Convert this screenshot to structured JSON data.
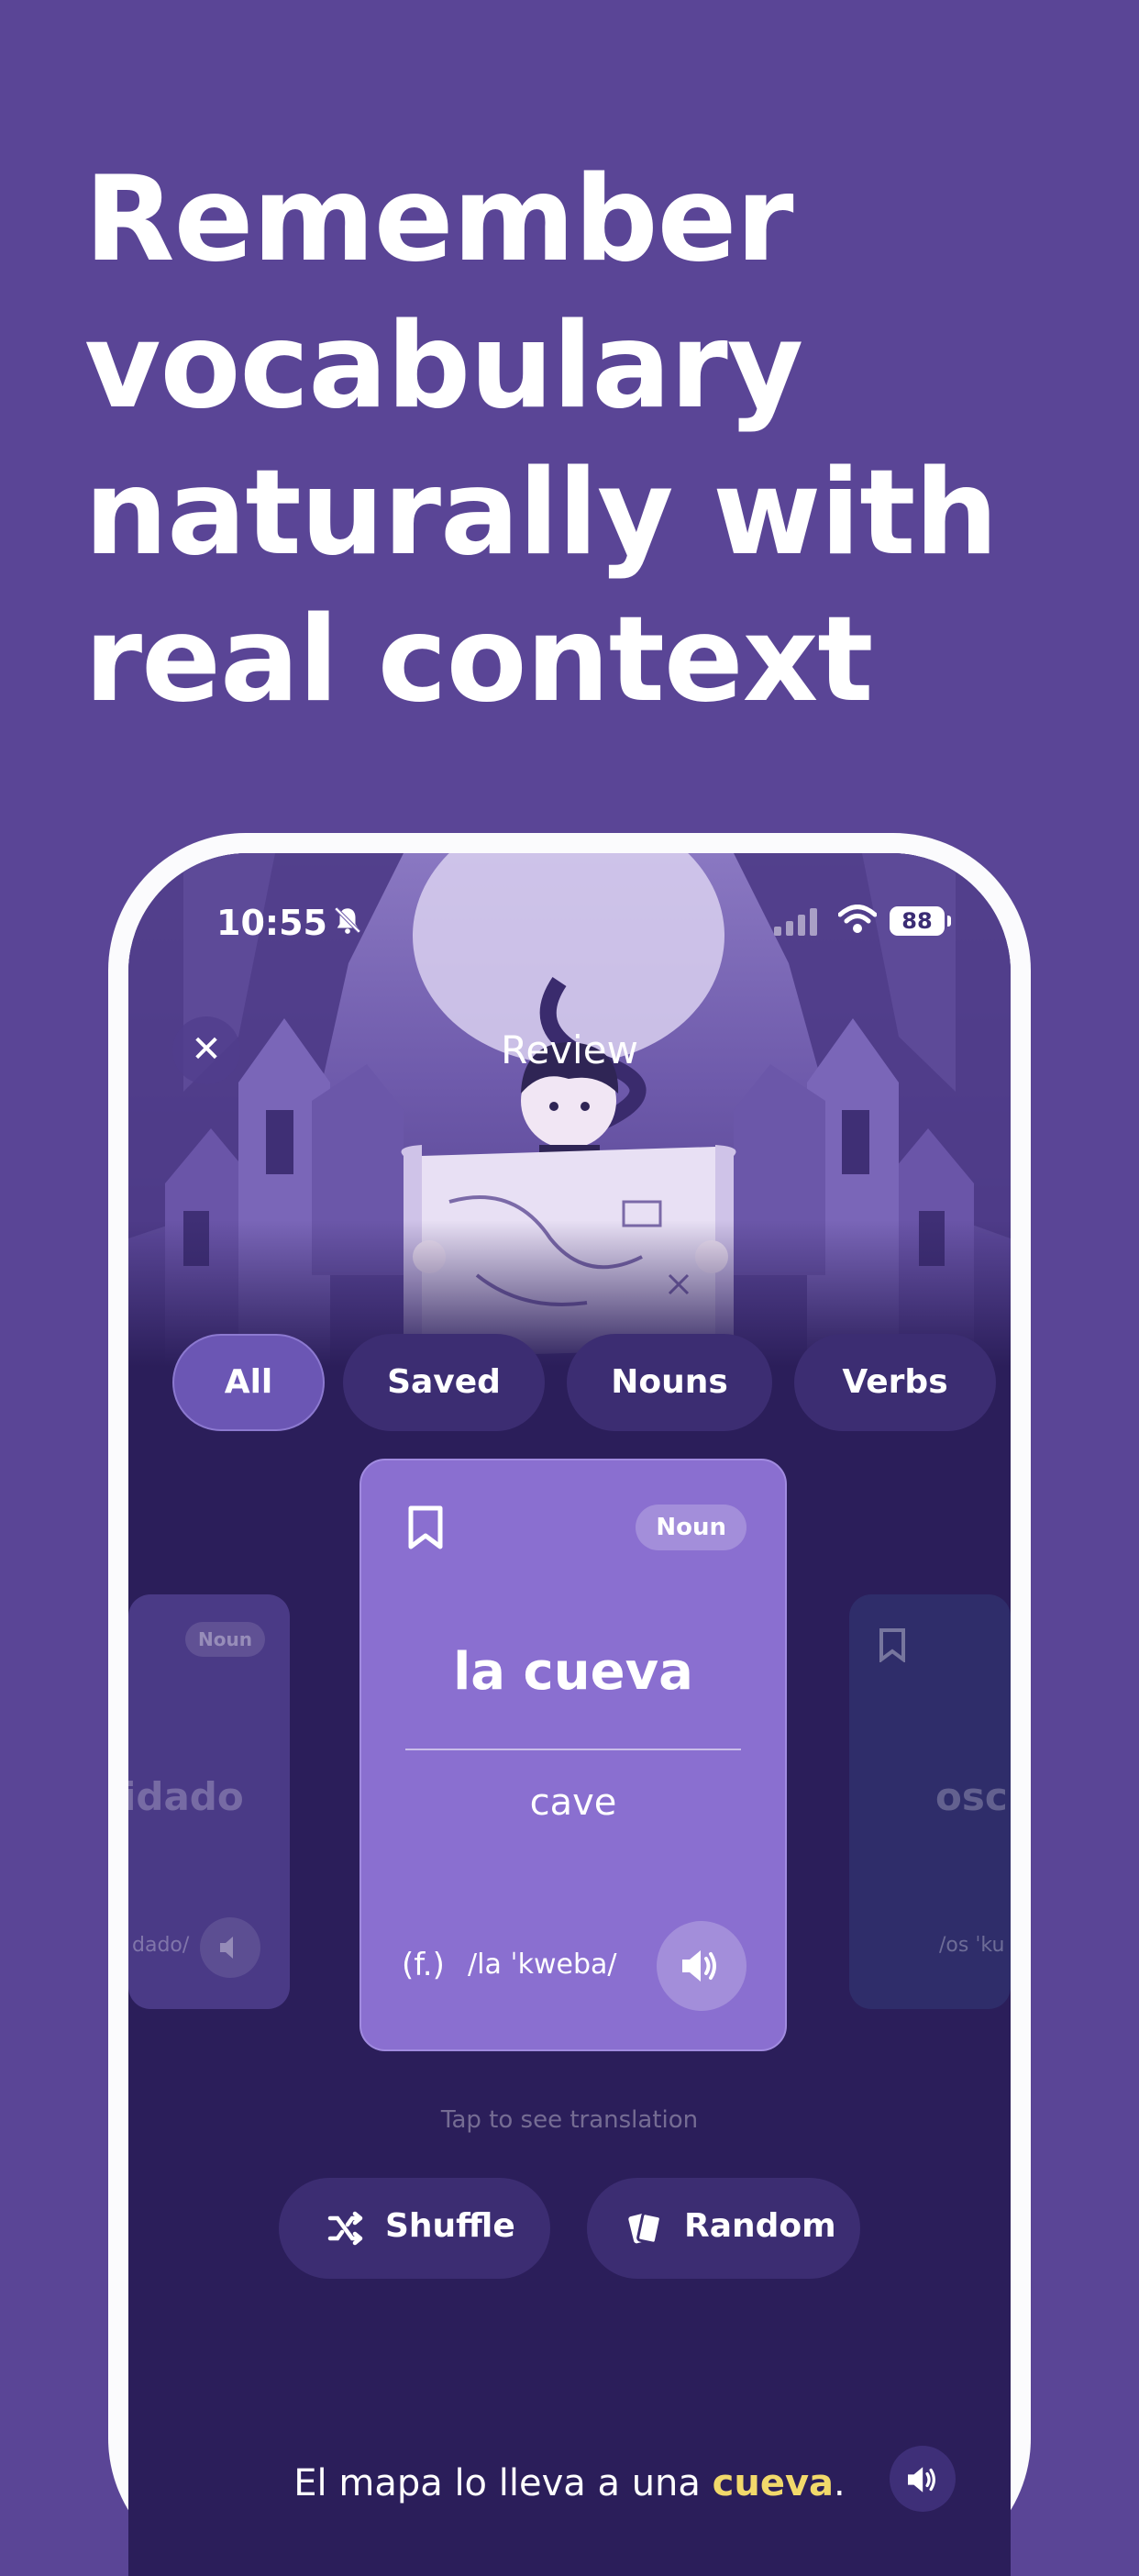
{
  "headline": {
    "lines": [
      "Remember",
      "vocabulary",
      "naturally with",
      "real context"
    ]
  },
  "status_bar": {
    "time": "10:55",
    "battery": "88"
  },
  "header": {
    "title": "Review",
    "close_icon": "close-icon"
  },
  "filters": [
    {
      "label": "All",
      "active": true
    },
    {
      "label": "Saved",
      "active": false
    },
    {
      "label": "Nouns",
      "active": false
    },
    {
      "label": "Verbs",
      "active": false
    }
  ],
  "cards": {
    "left": {
      "badge": "Noun",
      "word_fragment": "idado",
      "ipa_fragment": "dado/"
    },
    "current": {
      "badge": "Noun",
      "word": "la cueva",
      "translation": "cave",
      "gender": "(f.)",
      "ipa": "/la ˈkweba/"
    },
    "right": {
      "word_fragment": "oscu",
      "ipa_fragment": "/os ˈku"
    }
  },
  "hint": "Tap to see translation",
  "actions": {
    "shuffle": "Shuffle",
    "random": "Random"
  },
  "example": {
    "before": "El mapa lo lleva a una ",
    "highlight": "cueva",
    "after": "."
  },
  "colors": {
    "background": "#5a4596",
    "card": "#8a6fd0",
    "highlight": "#f2d96b"
  }
}
